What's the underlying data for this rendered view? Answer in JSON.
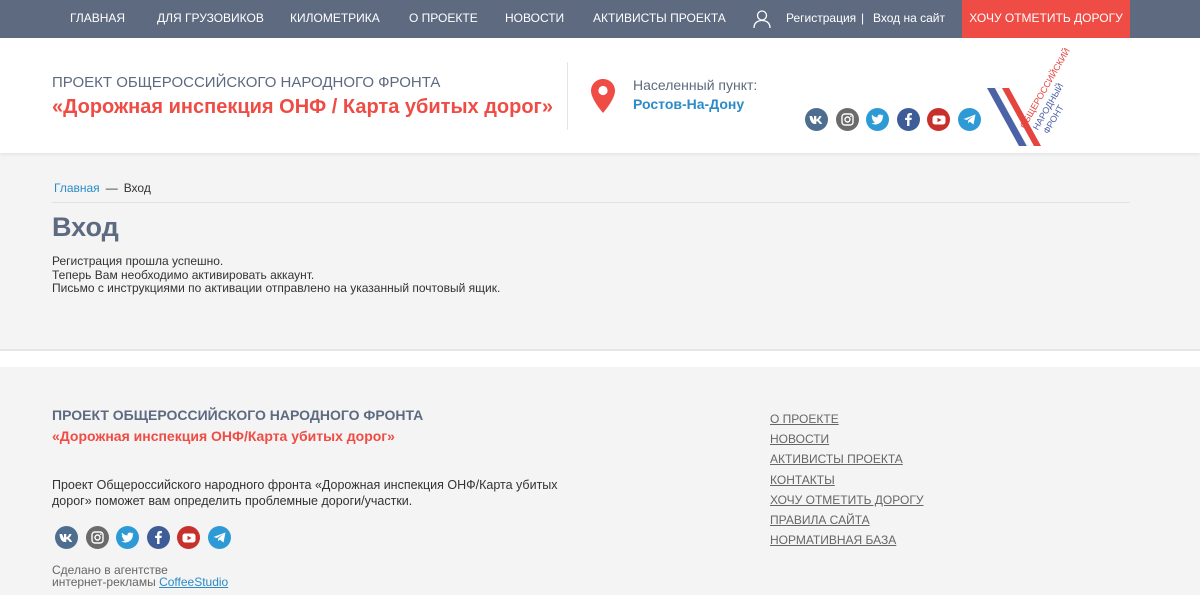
{
  "topnav": {
    "items": [
      "Главная",
      "Для грузовиков",
      "Километрика",
      "О проекте",
      "Новости",
      "Активисты проекта"
    ],
    "register": "Регистрация",
    "separator": "|",
    "login": "Вход на сайт",
    "cta": "Хочу отметить дорогу"
  },
  "header": {
    "project_line": "Проект общероссийского народного фронта",
    "project_title": "«Дорожная инспекция ОНФ / Карта убитых дорог»",
    "location_label": "Населенный пункт:",
    "location_value": "Ростов-На-Дону",
    "logo_text": [
      "ОБЩЕРОССИЙСКИЙ",
      "НАРОДНЫЙ",
      "ФРОНТ"
    ]
  },
  "social": {
    "icons": [
      "vk-icon",
      "instagram-icon",
      "twitter-icon",
      "facebook-icon",
      "youtube-icon",
      "telegram-icon"
    ]
  },
  "breadcrumb": {
    "home": "Главная",
    "separator": "—",
    "current": "Вход"
  },
  "main": {
    "title": "Вход",
    "lines": [
      "Регистрация прошла успешно.",
      "Теперь Вам необходимо активировать аккаунт.",
      "Письмо с инструкциями по активации отправлено на указанный почтовый ящик."
    ]
  },
  "footer": {
    "project_line": "Проект общероссийского народного фронта",
    "project_title": "«Дорожная инспекция ОНФ/Карта убитых дорог»",
    "description": "Проект Общероссийского народного фронта «Дорожная инспекция ОНФ/Карта убитых дорог» поможет вам определить проблемные дороги/участки.",
    "made_line1": "Сделано в агентстве",
    "made_line2": "интернет-рекламы",
    "agency": "CoffeeStudio",
    "links": [
      "О проекте",
      "Новости",
      "Активисты проекта",
      "Контакты",
      "Хочу отметить дорогу",
      "Правила сайта",
      "Нормативная база"
    ]
  },
  "colors": {
    "nav_bg": "#5d6a80",
    "accent_red": "#ef4c45",
    "link_blue": "#2b8bc7"
  }
}
